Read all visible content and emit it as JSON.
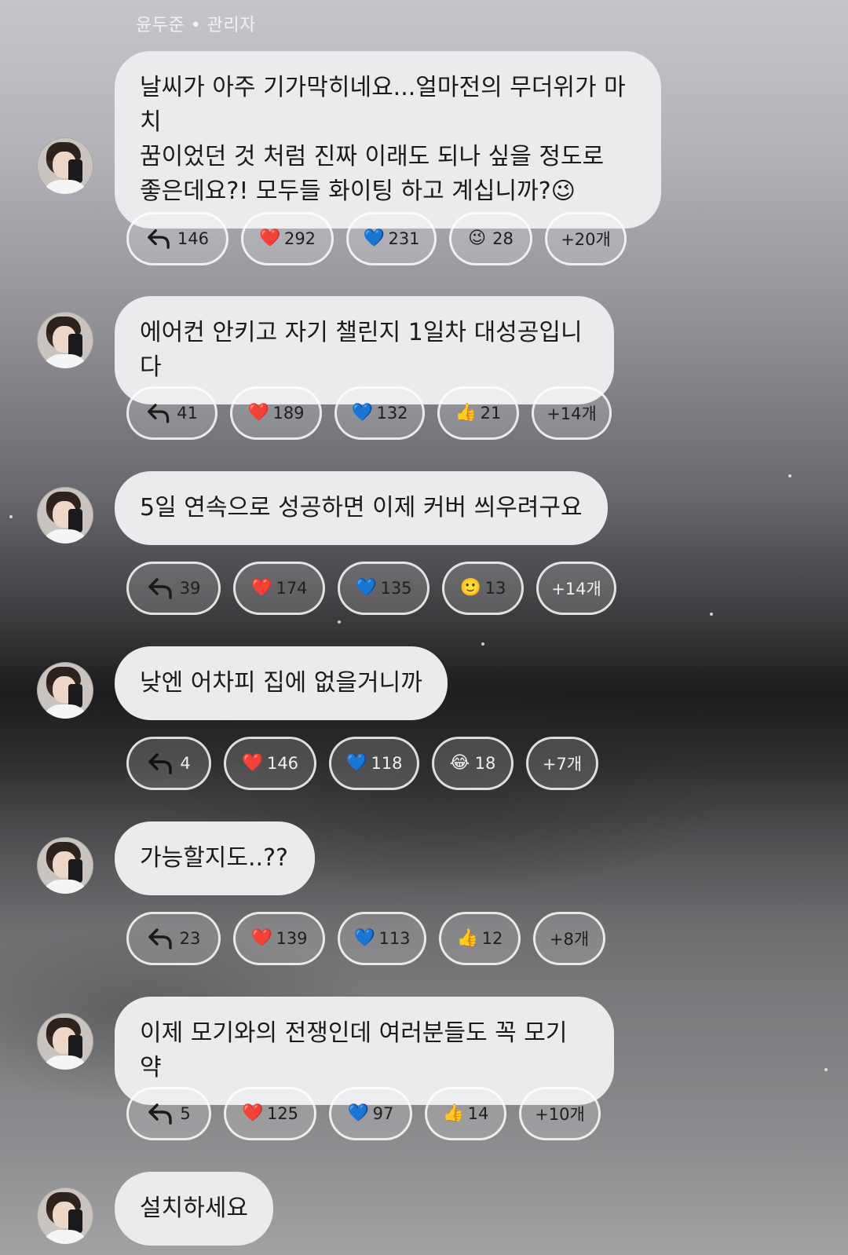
{
  "sender": "윤두준 • 관리자",
  "messages": [
    {
      "text": "날씨가 아주 기가막히네요...얼마전의 무더위가 마치\n꿈이었던 것 처럼 진짜 이래도 되나 싶을 정도로\n좋은데요?! 모두들 화이팅 하고 계십니까?😉",
      "replies": "146",
      "reactions": [
        {
          "emoji": "❤️",
          "icon": "red-heart-icon",
          "count": "292"
        },
        {
          "emoji": "💙",
          "icon": "blue-heart-icon",
          "count": "231"
        },
        {
          "emoji": "😉",
          "icon": "winking-face-icon",
          "count": "28"
        }
      ],
      "more": "+20개"
    },
    {
      "text": "에어컨 안키고 자기 챌린지 1일차 대성공입니다",
      "replies": "41",
      "reactions": [
        {
          "emoji": "❤️",
          "icon": "red-heart-icon",
          "count": "189"
        },
        {
          "emoji": "💙",
          "icon": "blue-heart-icon",
          "count": "132"
        },
        {
          "emoji": "👍",
          "icon": "thumbs-up-icon",
          "count": "21"
        }
      ],
      "more": "+14개"
    },
    {
      "text": "5일 연속으로 성공하면 이제 커버 씌우려구요",
      "replies": "39",
      "reactions": [
        {
          "emoji": "❤️",
          "icon": "red-heart-icon",
          "count": "174"
        },
        {
          "emoji": "💙",
          "icon": "blue-heart-icon",
          "count": "135"
        },
        {
          "emoji": "🙂",
          "icon": "smiling-face-icon",
          "count": "13"
        }
      ],
      "more": "+14개"
    },
    {
      "text": "낮엔 어차피 집에 없을거니까",
      "replies": "4",
      "reactions": [
        {
          "emoji": "❤️",
          "icon": "red-heart-icon",
          "count": "146"
        },
        {
          "emoji": "💙",
          "icon": "blue-heart-icon",
          "count": "118"
        },
        {
          "emoji": "😂",
          "icon": "tears-of-joy-icon",
          "count": "18"
        }
      ],
      "more": "+7개"
    },
    {
      "text": "가능할지도..??",
      "replies": "23",
      "reactions": [
        {
          "emoji": "❤️",
          "icon": "red-heart-icon",
          "count": "139"
        },
        {
          "emoji": "💙",
          "icon": "blue-heart-icon",
          "count": "113"
        },
        {
          "emoji": "👍",
          "icon": "thumbs-up-icon",
          "count": "12"
        }
      ],
      "more": "+8개"
    },
    {
      "text": "이제 모기와의 전쟁인데 여러분들도 꼭 모기약",
      "replies": "5",
      "reactions": [
        {
          "emoji": "❤️",
          "icon": "red-heart-icon",
          "count": "125"
        },
        {
          "emoji": "💙",
          "icon": "blue-heart-icon",
          "count": "97"
        },
        {
          "emoji": "👍",
          "icon": "thumbs-up-icon",
          "count": "14"
        }
      ],
      "more": "+10개"
    },
    {
      "text": "설치하세요",
      "replies": null,
      "reactions": [],
      "more": null
    }
  ]
}
